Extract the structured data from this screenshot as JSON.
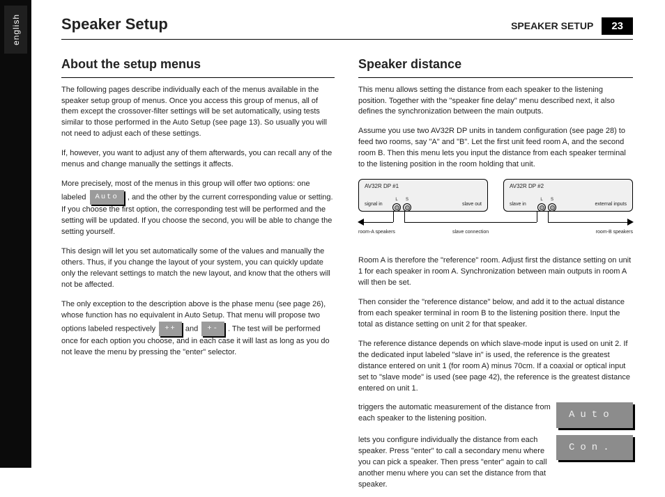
{
  "sidebar": {
    "label": "english"
  },
  "header": {
    "title": "Speaker Setup",
    "trail": "SPEAKER SETUP",
    "page": "23"
  },
  "left": {
    "section_title": "About the setup menus",
    "p1": "The following pages describe individually each of the menus available in the speaker setup group of menus. Once you access this group of menus, all of them except the crossover-filter settings will be set automatically, using tests similar to those performed in the Auto Setup (see page 13). So usually you will not need to adjust each of these settings.",
    "p2": "If, however, you want to adjust any of them afterwards, you can recall any of the menus and change manually the settings it affects.",
    "p3a": "More precisely, most of the menus in this group will offer two options: one labeled ",
    "p3_chip": "Auto",
    "p3b": ", and the other by the current corresponding value or setting. If you choose the first option, the corresponding test will be performed and the setting will be updated. If you choose the second, you will be able to change the setting yourself.",
    "p4": "This design will let you set automatically some of the values and manually the others. Thus, if you change the layout of your system, you can quickly update only the relevant settings to match the new layout, and know that the others will not be affected.",
    "p5a": "The only exception to the description above is the phase menu (see page 26), whose function has no equivalent in Auto Setup. That menu will propose two options labeled respectively ",
    "p5_chip1": "++",
    "p5b": " and ",
    "p5_chip2": "+-",
    "p5c": ". The test will be performed once for each option you choose, and in each case it will last as long as you do not leave the menu by pressing the \"enter\" selector."
  },
  "right": {
    "section_title": "Speaker distance",
    "p1": "This menu allows setting the distance from each speaker to the listening position. Together with the \"speaker fine delay\" menu described next, it also defines the synchronization between the main outputs.",
    "p2": "Assume you use two AV32R DP units in tandem configuration (see page 28) to feed two rooms, say \"A\" and \"B\". Let the first unit feed room A, and the second room B. Then this menu lets you input the distance from each speaker terminal to the listening position in the room holding that unit.",
    "diagram": {
      "boxA_title": "AV32R DP #1",
      "boxB_title": "AV32R DP #2",
      "caption_in": "signal in",
      "caption_slave": "slave in",
      "caption_out": "slave out",
      "caption_ext": "external inputs",
      "term_l": "L",
      "term_s": "S",
      "left_annot": "room-A speakers",
      "mid_annot": "slave connection",
      "right_annot": "room-B speakers"
    },
    "p3": "Room A is therefore the \"reference\" room. Adjust first the distance setting on unit 1 for each speaker in room A. Synchronization between main outputs in room A will then be set.",
    "p4": "Then consider the \"reference distance\" below, and add it to the actual distance from each speaker terminal in room B to the listening position there. Input the total as distance setting on unit 2 for that speaker.",
    "p5": "The reference distance depends on which slave-mode input is used on unit 2. If the dedicated input labeled \"slave in\" is used, the reference is the greatest distance entered on unit 1 (for room A) minus 70cm. If a coaxial or optical input set to \"slave mode\" is used (see page 42), the reference is the greatest distance entered on unit 1.",
    "auto_txt": "triggers the automatic measurement of the distance from each speaker to the listening position.",
    "auto_chip": "Auto",
    "con_txt": "lets you configure individually the distance from each speaker. Press \"enter\" to call a secondary menu where you can pick a speaker. Then press \"enter\" again to call another menu where you can set the distance from that speaker.",
    "con_chip": "Con."
  }
}
